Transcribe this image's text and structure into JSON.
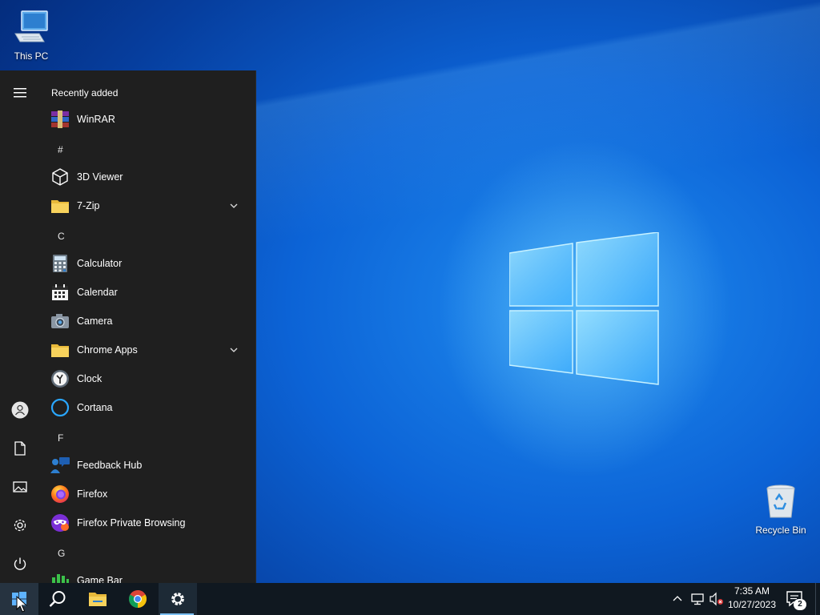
{
  "desktop": {
    "icons": [
      {
        "label": "This PC",
        "icon": "this-pc-icon"
      },
      {
        "label": "Recycle Bin",
        "icon": "recycle-bin-icon"
      }
    ]
  },
  "start_menu": {
    "rail": [
      "hamburger-menu-icon",
      "user-account-icon",
      "documents-icon",
      "pictures-icon",
      "settings-icon",
      "power-icon"
    ],
    "recently_added_label": "Recently added",
    "apps": [
      {
        "label": "WinRAR",
        "icon": "winrar-icon"
      },
      {
        "letter": "#"
      },
      {
        "label": "3D Viewer",
        "icon": "3d-viewer-icon"
      },
      {
        "label": "7-Zip",
        "icon": "folder-icon",
        "expandable": true
      },
      {
        "letter": "C"
      },
      {
        "label": "Calculator",
        "icon": "calculator-icon"
      },
      {
        "label": "Calendar",
        "icon": "calendar-icon"
      },
      {
        "label": "Camera",
        "icon": "camera-icon"
      },
      {
        "label": "Chrome Apps",
        "icon": "folder-icon",
        "expandable": true
      },
      {
        "label": "Clock",
        "icon": "clock-icon"
      },
      {
        "label": "Cortana",
        "icon": "cortana-icon"
      },
      {
        "letter": "F"
      },
      {
        "label": "Feedback Hub",
        "icon": "feedback-hub-icon"
      },
      {
        "label": "Firefox",
        "icon": "firefox-icon"
      },
      {
        "label": "Firefox Private Browsing",
        "icon": "firefox-private-icon"
      },
      {
        "letter": "G"
      },
      {
        "label": "Game Bar",
        "icon": "game-bar-icon"
      }
    ]
  },
  "taskbar": {
    "buttons": [
      "start-icon",
      "search-icon",
      "file-explorer-icon",
      "chrome-icon",
      "settings-icon"
    ],
    "tray": {
      "time": "7:35 AM",
      "date": "10/27/2023",
      "notification_count": "2"
    }
  },
  "colors": {
    "start_bg": "#1f1f1f",
    "taskbar_bg": "#101820",
    "accent": "#7cc0f3"
  }
}
